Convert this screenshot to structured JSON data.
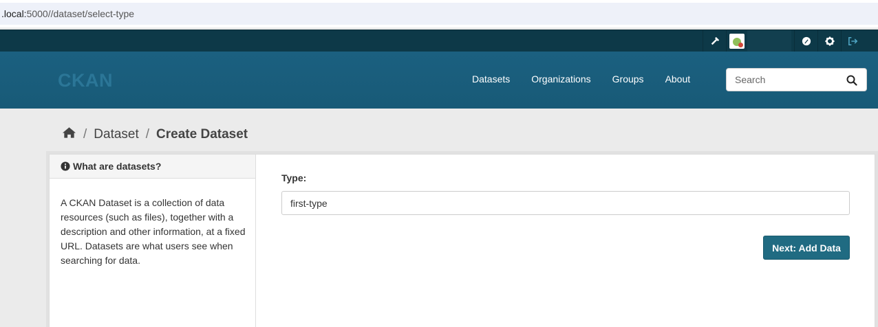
{
  "browser": {
    "url_host": ".local:",
    "url_path": "5000//dataset/select-type"
  },
  "account": {
    "icons": [
      "sysadmin-hammer-icon",
      "user-avatar",
      "dashboard-icon",
      "settings-gear-icon",
      "logout-icon"
    ]
  },
  "header": {
    "logo": "CKAN",
    "nav": [
      "Datasets",
      "Organizations",
      "Groups",
      "About"
    ],
    "search_placeholder": "Search"
  },
  "breadcrumb": {
    "items": [
      "Dataset",
      "Create Dataset"
    ]
  },
  "sidebar": {
    "title": "What are datasets?",
    "body": "A CKAN Dataset is a collection of data resources (such as files), together with a description and other information, at a fixed URL. Datasets are what users see when searching for data."
  },
  "form": {
    "type_label": "Type:",
    "type_value": "first-type",
    "submit_label": "Next: Add Data"
  },
  "colors": {
    "masthead": "#1a5d7a",
    "account_bar": "#0d3948",
    "primary_button": "#206b82",
    "page_background": "#ebebeb"
  }
}
